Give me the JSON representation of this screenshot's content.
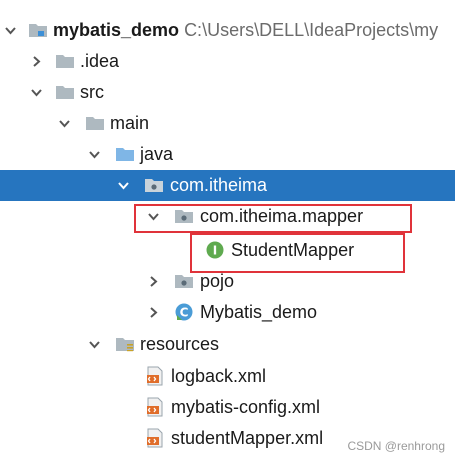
{
  "project": {
    "name": "mybatis_demo",
    "path": "C:\\Users\\DELL\\IdeaProjects\\my"
  },
  "tree": {
    "idea": ".idea",
    "src": "src",
    "main": "main",
    "java": "java",
    "package": "com.itheima",
    "mapper_package": "com.itheima.mapper",
    "mapper_interface": "StudentMapper",
    "interface_badge": "I",
    "pojo": "pojo",
    "class_badge": "C",
    "main_class": "Mybatis_demo",
    "resources": "resources",
    "files": [
      "logback.xml",
      "mybatis-config.xml",
      "studentMapper.xml"
    ]
  },
  "watermark": "CSDN @renhrong",
  "colors": {
    "selection": "#2675bf",
    "highlight_box": "#e0333a",
    "folder": "#aeb9c0",
    "module_folder": "#3c8fd6",
    "interface_icon": "#5faa4f",
    "class_icon": "#4a9cd6",
    "xml_icon": "#e06d2a"
  }
}
